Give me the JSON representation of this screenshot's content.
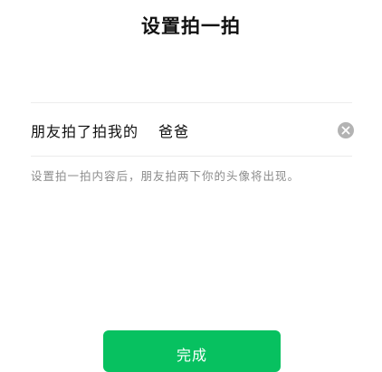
{
  "header": {
    "title": "设置拍一拍"
  },
  "pat_setting": {
    "prefix_text": "朋友拍了拍我的",
    "suffix_value": "爸爸",
    "clear_icon": "clear-circle-icon"
  },
  "hint": {
    "text": "设置拍一拍内容后，朋友拍两下你的头像将出现。"
  },
  "footer": {
    "done_label": "完成"
  },
  "colors": {
    "accent": "#07c160",
    "divider": "#ececec",
    "hint_text": "#8c8c8c",
    "clear_icon": "#b3b3b3"
  }
}
